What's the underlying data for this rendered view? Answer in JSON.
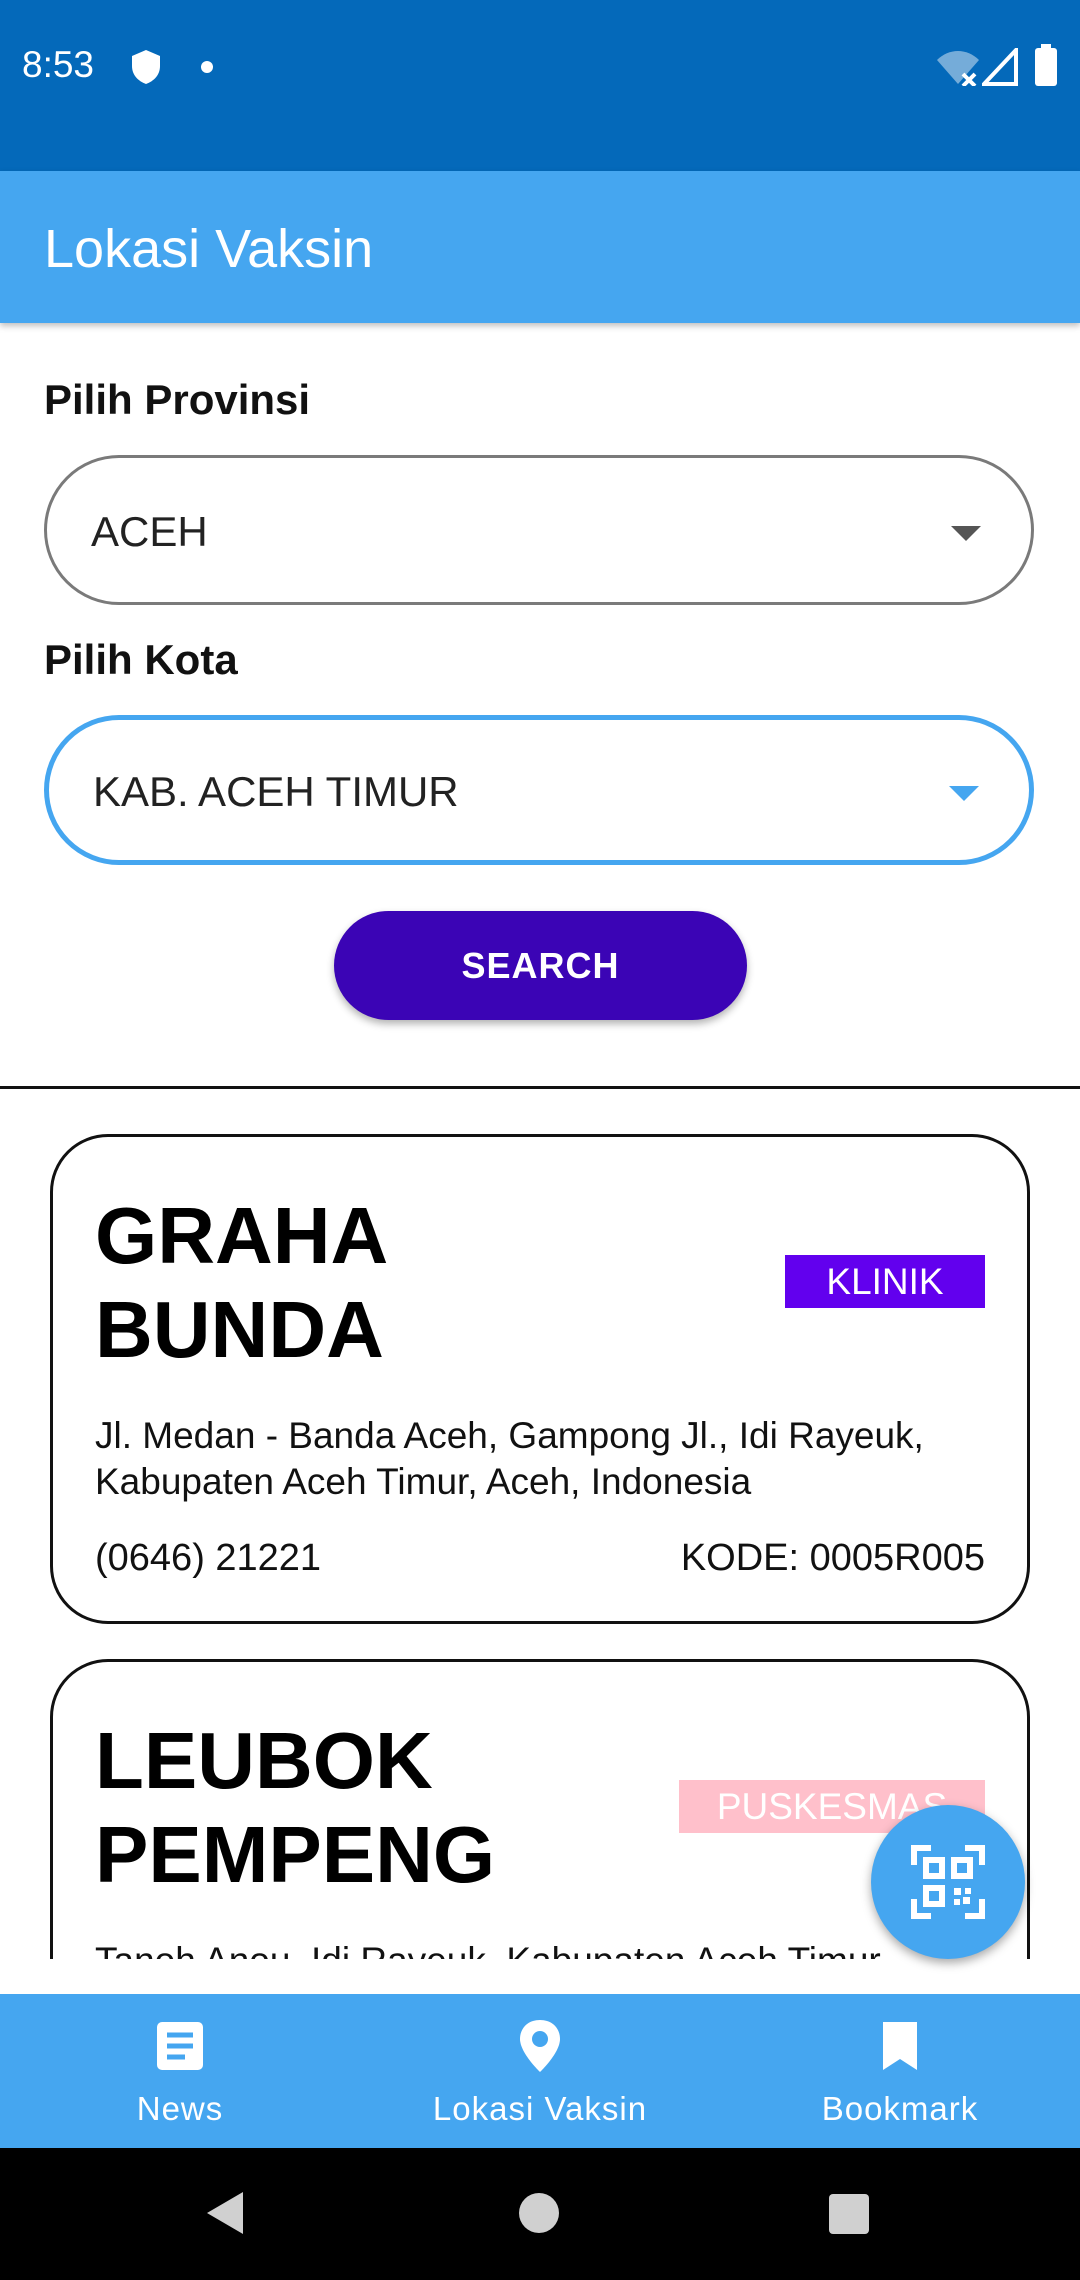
{
  "status_bar": {
    "time": "8:53"
  },
  "app_bar": {
    "title": "Lokasi Vaksin"
  },
  "form": {
    "province_label": "Pilih Provinsi",
    "province_value": "ACEH",
    "city_label": "Pilih Kota",
    "city_value": "KAB. ACEH TIMUR",
    "search_label": "SEARCH"
  },
  "results": [
    {
      "name": "GRAHA BUNDA",
      "type": "KLINIK",
      "type_color": "#6200EE",
      "address": "Jl. Medan - Banda Aceh, Gampong Jl., Idi Rayeuk, Kabupaten Aceh Timur, Aceh, Indonesia",
      "phone": "(0646) 21221",
      "code": "KODE: 0005R005"
    },
    {
      "name": "LEUBOK PEMPENG",
      "type": "PUSKESMAS",
      "type_color": "#FFC0CB",
      "address": "Tanoh Anou, Idi Rayeuk, Kabupaten Aceh Timur,"
    }
  ],
  "fab": {
    "icon": "qr-code-icon"
  },
  "bottom_nav": {
    "items": [
      {
        "label": "News",
        "icon": "news-icon"
      },
      {
        "label": "Lokasi Vaksin",
        "icon": "location-pin-icon"
      },
      {
        "label": "Bookmark",
        "icon": "bookmark-icon"
      }
    ]
  },
  "colors": {
    "status_bar": "#0469BA",
    "primary": "#45A6F0",
    "button": "#3B04B5"
  }
}
